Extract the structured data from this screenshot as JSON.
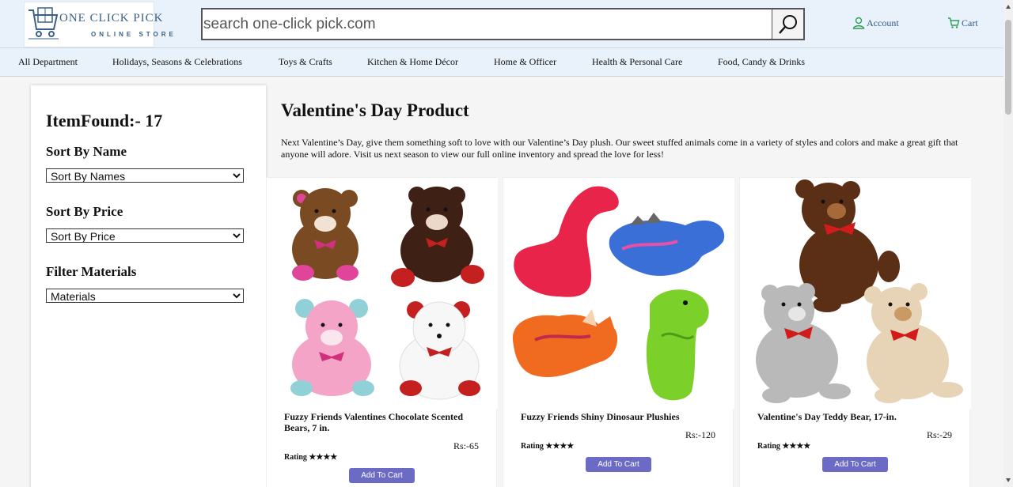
{
  "header": {
    "logo_brand": "ONE CLICK PICK",
    "logo_sub": "ONLINE STORE",
    "search_placeholder": "search one-click pick.com",
    "account_label": "Account",
    "cart_label": "Cart"
  },
  "nav": {
    "items": [
      "All Department",
      "Holidays, Seasons & Celebrations",
      "Toys & Crafts",
      "Kitchen & Home Décor",
      "Home & Officer",
      "Health & Personal Care",
      "Food, Candy & Drinks"
    ]
  },
  "sidebar": {
    "item_found": "ItemFound:- 17",
    "sort_name_label": "Sort By Name",
    "sort_name_value": "Sort By Names",
    "sort_price_label": "Sort By Price",
    "sort_price_value": "Sort By Price",
    "filter_label": "Filter Materials",
    "filter_value": "Materials"
  },
  "main": {
    "title": "Valentine's Day Product",
    "description": "Next Valentine’s Day, give them something soft to love with our Valentine’s Day plush. Our sweet stuffed animals come in a variety of styles and colors and make a great gift that anyone will adore. Visit us next season to view our full online inventory and spread the love for less!"
  },
  "products": [
    {
      "name": "Fuzzy Friends Valentines Chocolate Scented Bears, 7 in.",
      "price": "Rs:-65",
      "rating": "Rating ★★★★",
      "button": "Add To Cart"
    },
    {
      "name": "Fuzzy Friends Shiny Dinosaur Plushies",
      "price": "Rs:-120",
      "rating": "Rating ★★★★",
      "button": "Add To Cart"
    },
    {
      "name": "Valentine's Day Teddy Bear, 17-in.",
      "price": "Rs:-29",
      "rating": "Rating ★★★★",
      "button": "Add To Cart"
    }
  ],
  "colors": {
    "header_bg": "#e9f1fb",
    "brand": "#3b5f85",
    "button": "#6b6bc6",
    "icon_green": "#2e9d57"
  },
  "icons": [
    "shopping-cart-logo-icon",
    "search-icon",
    "user-icon",
    "cart-icon"
  ]
}
